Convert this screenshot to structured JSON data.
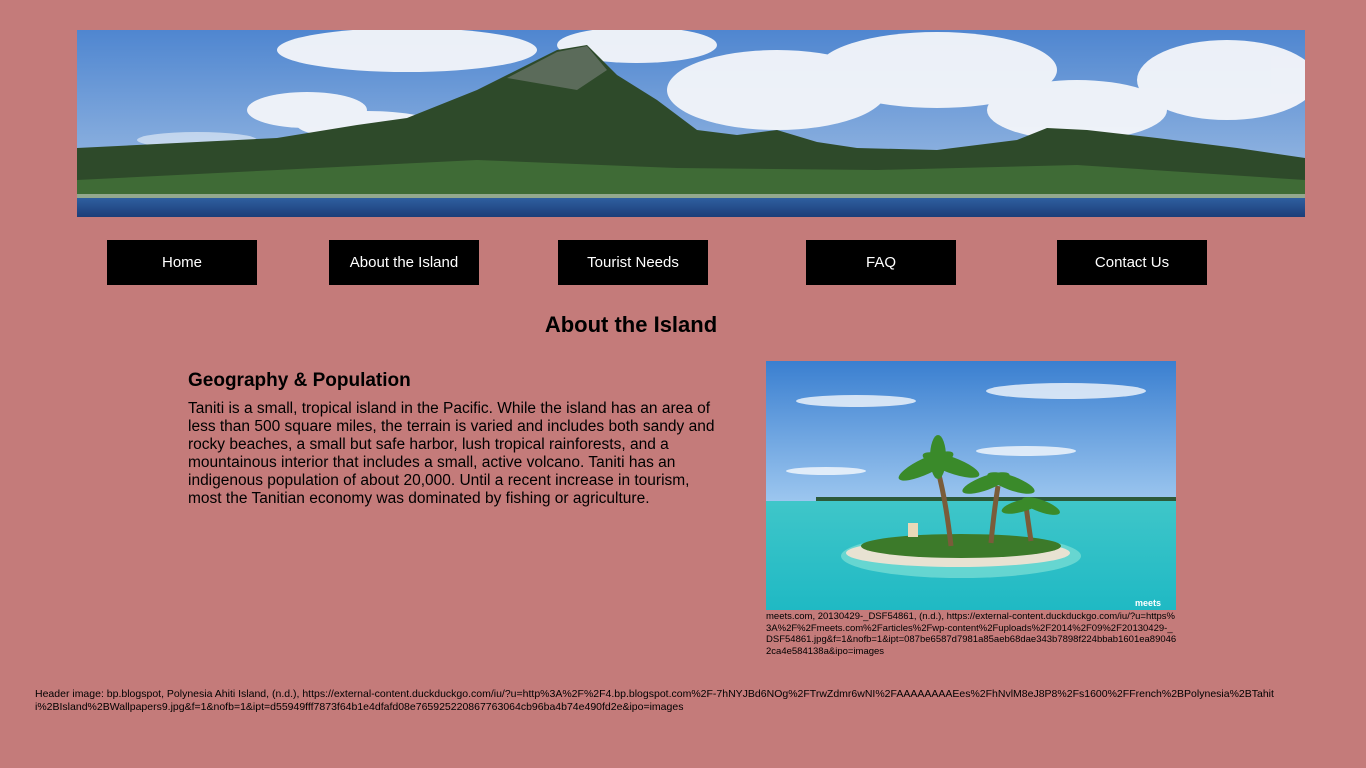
{
  "header": {
    "banner_image": "mountain-island-panorama"
  },
  "nav": {
    "items": [
      {
        "label": "Home"
      },
      {
        "label": "About the Island"
      },
      {
        "label": "Tourist Needs"
      },
      {
        "label": "FAQ"
      },
      {
        "label": "Contact Us"
      }
    ]
  },
  "main": {
    "title": "About the Island",
    "section": {
      "heading": "Geography & Population",
      "body": "Taniti is a small, tropical island in the Pacific. While the island has an area of less than 500 square miles, the terrain is varied and includes both sandy and rocky beaches, a small but safe harbor, lush tropical rainforests, and a mountainous interior that includes a small, active volcano. Taniti has an indigenous population of about 20,000. Until a recent increase in tourism, most the Tanitian economy was dominated by fishing or agriculture."
    },
    "photo": {
      "image": "palm-islet-lagoon",
      "watermark": "meets",
      "credit": "meets.com, 20130429-_DSF54861, (n.d.), https://external-content.duckduckgo.com/iu/?u=https%3A%2F%2Fmeets.com%2Farticles%2Fwp-content%2Fuploads%2F2014%2F09%2F20130429-_DSF54861.jpg&f=1&nofb=1&ipt=087be6587d7981a85aeb68dae343b7898f224bbab1601ea890462ca4e584138a&ipo=images"
    }
  },
  "footer": {
    "header_credit": "Header image: bp.blogspot, Polynesia Ahiti Island, (n.d.), https://external-content.duckduckgo.com/iu/?u=http%3A%2F%2F4.bp.blogspot.com%2F-7hNYJBd6NOg%2FTrwZdmr6wNI%2FAAAAAAAAEes%2FhNvlM8eJ8P8%2Fs1600%2FFrench%2BPolynesia%2BTahiti%2BIsland%2BWallpapers9.jpg&f=1&nofb=1&ipt=d55949fff7873f64b1e4dfafd08e765925220867763064cb96ba4b74e490fd2e&ipo=images"
  },
  "colors": {
    "page_background": "#c47b7a",
    "nav_button": "#000000",
    "nav_text": "#ffffff"
  }
}
